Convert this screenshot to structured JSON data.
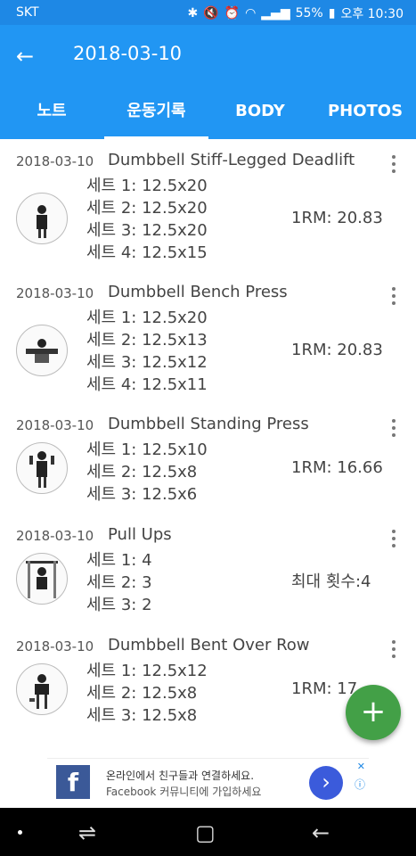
{
  "status": {
    "carrier": "SKT",
    "battery": "55%",
    "time": "오후 10:30"
  },
  "appbar": {
    "back_icon": "arrow-left-icon",
    "title": "2018-03-10"
  },
  "tabs": [
    {
      "label": "노트"
    },
    {
      "label": "운동기록",
      "active": true
    },
    {
      "label": "BODY"
    },
    {
      "label": "PHOTOS"
    }
  ],
  "workouts": [
    {
      "date": "2018-03-10",
      "name": "Dumbbell Stiff-Legged Deadlift",
      "sets": [
        "세트 1: 12.5x20",
        "세트 2: 12.5x20",
        "세트 3: 12.5x20",
        "세트 4: 12.5x15"
      ],
      "rm": "1RM:  20.83"
    },
    {
      "date": "2018-03-10",
      "name": "Dumbbell Bench Press",
      "sets": [
        "세트 1: 12.5x20",
        "세트 2: 12.5x13",
        "세트 3: 12.5x12",
        "세트 4: 12.5x11"
      ],
      "rm": "1RM:  20.83"
    },
    {
      "date": "2018-03-10",
      "name": "Dumbbell Standing Press",
      "sets": [
        "세트 1: 12.5x10",
        "세트 2: 12.5x8",
        "세트 3: 12.5x6"
      ],
      "rm": "1RM:  16.66"
    },
    {
      "date": "2018-03-10",
      "name": "Pull Ups",
      "sets": [
        "세트 1: 4",
        "세트 2: 3",
        "세트 3: 2"
      ],
      "rm": "최대 횟수:4"
    },
    {
      "date": "2018-03-10",
      "name": "Dumbbell Bent Over Row",
      "sets": [
        "세트 1: 12.5x12",
        "세트 2: 12.5x8",
        "세트 3: 12.5x8"
      ],
      "rm": "1RM:  17"
    }
  ],
  "fab": {
    "label": "+"
  },
  "ad": {
    "logo": "f",
    "line1": "온라인에서 친구들과 연결하세요.",
    "line2": "Facebook 커뮤니티에 가입하세요",
    "go": "›",
    "close": "✕",
    "info": "ⓘ"
  },
  "navbar": {
    "recent_icon": "recent-apps-icon",
    "home_icon": "home-icon",
    "back_icon": "back-icon"
  },
  "colors": {
    "primary": "#2196f3",
    "status": "#1e88e5",
    "fab": "#43a047"
  }
}
